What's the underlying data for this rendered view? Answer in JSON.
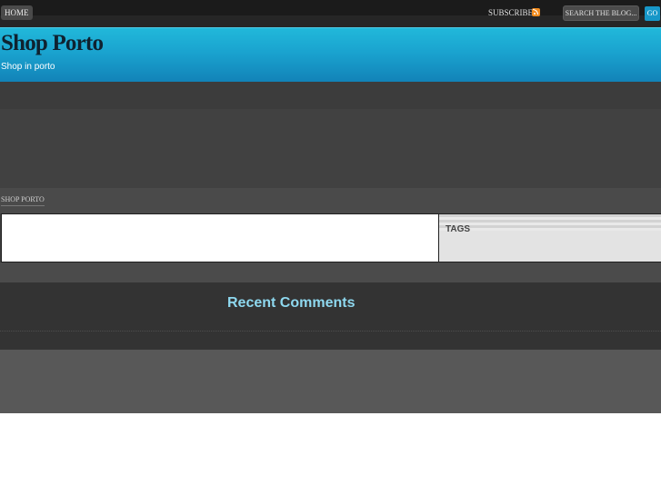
{
  "nav": {
    "home_label": "HOME",
    "subscribe_label": "SUBSCRIBE",
    "rss_icon": "rss-icon",
    "search_placeholder": "SEARCH THE BLOG...",
    "go_label": "GO"
  },
  "header": {
    "title": "Shop Porto",
    "tagline": "Shop in porto"
  },
  "breadcrumb": {
    "label": "SHOP PORTO"
  },
  "sidebar": {
    "tags_title": "TAGS"
  },
  "footer": {
    "widget_title": "Recent Comments"
  },
  "colors": {
    "accent": "#1797c8",
    "header_top": "#21b8da",
    "header_bottom": "#1283b8",
    "rss": "#f28c1e",
    "footer_title": "#8ed8ef"
  }
}
